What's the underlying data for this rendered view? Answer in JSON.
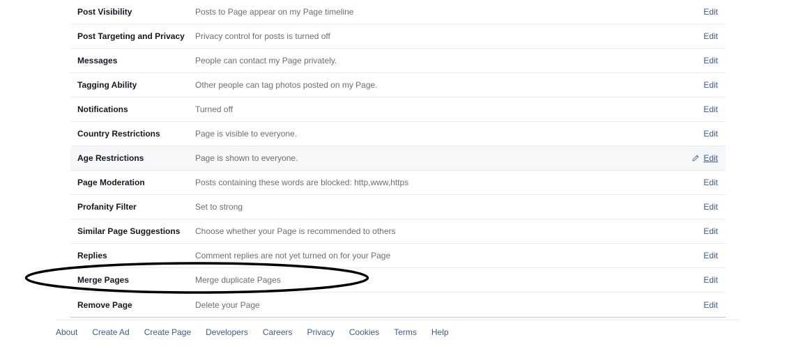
{
  "settings": [
    {
      "label": "Post Visibility",
      "value": "Posts to Page appear on my Page timeline",
      "edit": "Edit"
    },
    {
      "label": "Post Targeting and Privacy",
      "value": "Privacy control for posts is turned off",
      "edit": "Edit"
    },
    {
      "label": "Messages",
      "value": "People can contact my Page privately.",
      "edit": "Edit"
    },
    {
      "label": "Tagging Ability",
      "value": "Other people can tag photos posted on my Page.",
      "edit": "Edit"
    },
    {
      "label": "Notifications",
      "value": "Turned off",
      "edit": "Edit"
    },
    {
      "label": "Country Restrictions",
      "value": "Page is visible to everyone.",
      "edit": "Edit"
    },
    {
      "label": "Age Restrictions",
      "value": "Page is shown to everyone.",
      "edit": "Edit",
      "hovered": true
    },
    {
      "label": "Page Moderation",
      "value": "Posts containing these words are blocked: http,www,https",
      "edit": "Edit"
    },
    {
      "label": "Profanity Filter",
      "value": "Set to strong",
      "edit": "Edit"
    },
    {
      "label": "Similar Page Suggestions",
      "value": "Choose whether your Page is recommended to others",
      "edit": "Edit"
    },
    {
      "label": "Replies",
      "value": "Comment replies are not yet turned on for your Page",
      "edit": "Edit"
    },
    {
      "label": "Merge Pages",
      "value": "Merge duplicate Pages",
      "edit": "Edit"
    },
    {
      "label": "Remove Page",
      "value": "Delete your Page",
      "edit": "Edit"
    }
  ],
  "footer": {
    "links": [
      "About",
      "Create Ad",
      "Create Page",
      "Developers",
      "Careers",
      "Privacy",
      "Cookies",
      "Terms",
      "Help"
    ]
  },
  "icons": {
    "edit_pencil": "pencil-icon"
  },
  "colors": {
    "link": "#3b5998",
    "label": "#141823",
    "value": "#6e6e6e",
    "row_border": "#e9eaed",
    "hover_row": "#f6f7f8",
    "annotation": "#000000"
  }
}
